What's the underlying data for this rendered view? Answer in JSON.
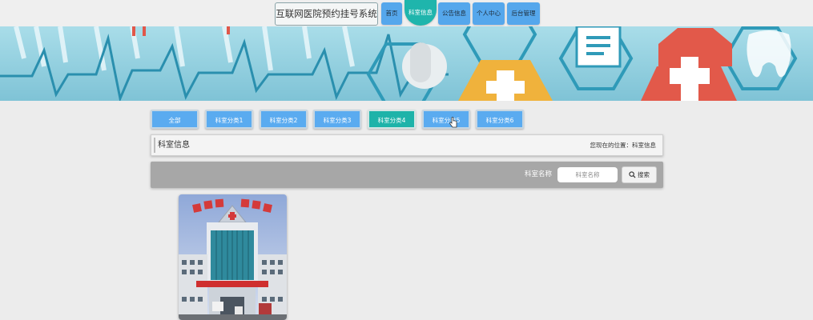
{
  "header": {
    "site_title": "互联网医院预约挂号系统",
    "nav": [
      {
        "label": "首页",
        "active": false
      },
      {
        "label": "科室信息",
        "active": true
      },
      {
        "label": "公告信息",
        "active": false
      },
      {
        "label": "个人中心",
        "active": false
      },
      {
        "label": "后台管理",
        "active": false
      }
    ]
  },
  "categories": [
    {
      "label": "全部",
      "active": false
    },
    {
      "label": "科室分类1",
      "active": false
    },
    {
      "label": "科室分类2",
      "active": false
    },
    {
      "label": "科室分类3",
      "active": false
    },
    {
      "label": "科室分类4",
      "active": true
    },
    {
      "label": "科室分类5",
      "active": false
    },
    {
      "label": "科室分类6",
      "active": false
    }
  ],
  "breadcrumb": {
    "title": "科室信息",
    "location": "您现在的位置：科室信息"
  },
  "search": {
    "label": "科室名称",
    "placeholder": "科室名称",
    "value": "",
    "button_label": "搜索"
  },
  "colors": {
    "nav_blue": "#55a7ec",
    "accent_teal": "#1fb5ac",
    "search_bar_gray": "#a7a7a7",
    "banner_bg": "#8ccfe0"
  },
  "icons": {
    "search_button": "search-icon",
    "cursor": "pointer-cursor-icon"
  }
}
